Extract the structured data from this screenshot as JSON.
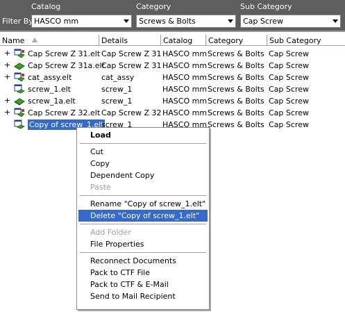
{
  "filter": {
    "filter_by_label": "Filter By",
    "catalog": {
      "header": "Catalog",
      "value": "HASCO mm"
    },
    "category": {
      "header": "Category",
      "value": "Screws & Bolts"
    },
    "sub_category": {
      "header": "Sub Category",
      "value": "Cap Screw"
    }
  },
  "columns": [
    "Name",
    "Details",
    "Catalog",
    "Category",
    "Sub Category"
  ],
  "rows": [
    {
      "expand": "+",
      "icon": "assembly-icon",
      "name": "Cap Screw Z 31.elt",
      "details": "Cap Screw Z 31",
      "catalog": "HASCO mm",
      "category": "Screws & Bolts",
      "sub_category": "Cap Screw"
    },
    {
      "expand": "+",
      "icon": "part-green-icon",
      "name": "Cap Screw Z 31a.elt",
      "details": "Cap Screw Z 31",
      "catalog": "HASCO mm",
      "category": "Screws & Bolts",
      "sub_category": "Cap Screw"
    },
    {
      "expand": "+",
      "icon": "assembly-icon",
      "name": "cat_assy.elt",
      "details": "cat_assy",
      "catalog": "HASCO mm",
      "category": "Screws & Bolts",
      "sub_category": "Cap Screw"
    },
    {
      "expand": "",
      "icon": "part-icon",
      "name": "screw_1.elt",
      "details": "screw_1",
      "catalog": "HASCO mm",
      "category": "Screws & Bolts",
      "sub_category": "Cap Screw"
    },
    {
      "expand": "+",
      "icon": "part-green-icon",
      "name": "screw_1a.elt",
      "details": "screw_1",
      "catalog": "HASCO mm",
      "category": "Screws & Bolts",
      "sub_category": "Cap Screw"
    },
    {
      "expand": "+",
      "icon": "assembly-icon",
      "name": "Cap Screw Z 32.elt",
      "details": "Cap Screw Z 32",
      "catalog": "HASCO mm",
      "category": "Screws & Bolts",
      "sub_category": "Cap Screw"
    },
    {
      "expand": "",
      "icon": "part-icon",
      "name": "Copy of screw_1.elt",
      "details": "screw_1",
      "catalog": "HASCO mm",
      "category": "Screws & Bolts",
      "sub_category": "Cap Screw",
      "selected": true
    }
  ],
  "context_menu": {
    "items": [
      {
        "label": "Load",
        "bold": true
      },
      {
        "separator": true
      },
      {
        "label": "Cut"
      },
      {
        "label": "Copy"
      },
      {
        "label": "Dependent Copy"
      },
      {
        "label": "Paste",
        "disabled": true
      },
      {
        "separator": true
      },
      {
        "label": "Rename \"Copy of screw_1.elt\""
      },
      {
        "label": "Delete \"Copy of screw_1.elt\"",
        "highlighted": true
      },
      {
        "separator": true
      },
      {
        "label": "Add Folder",
        "disabled": true
      },
      {
        "label": "File Properties"
      },
      {
        "separator": true
      },
      {
        "label": "Reconnect Documents"
      },
      {
        "label": "Pack to CTF File"
      },
      {
        "label": "Pack to CTF & E-Mail"
      },
      {
        "label": "Send to Mail Recipient"
      }
    ]
  },
  "colors": {
    "header_bg": "#5e5e5e",
    "selection": "#336acc"
  }
}
